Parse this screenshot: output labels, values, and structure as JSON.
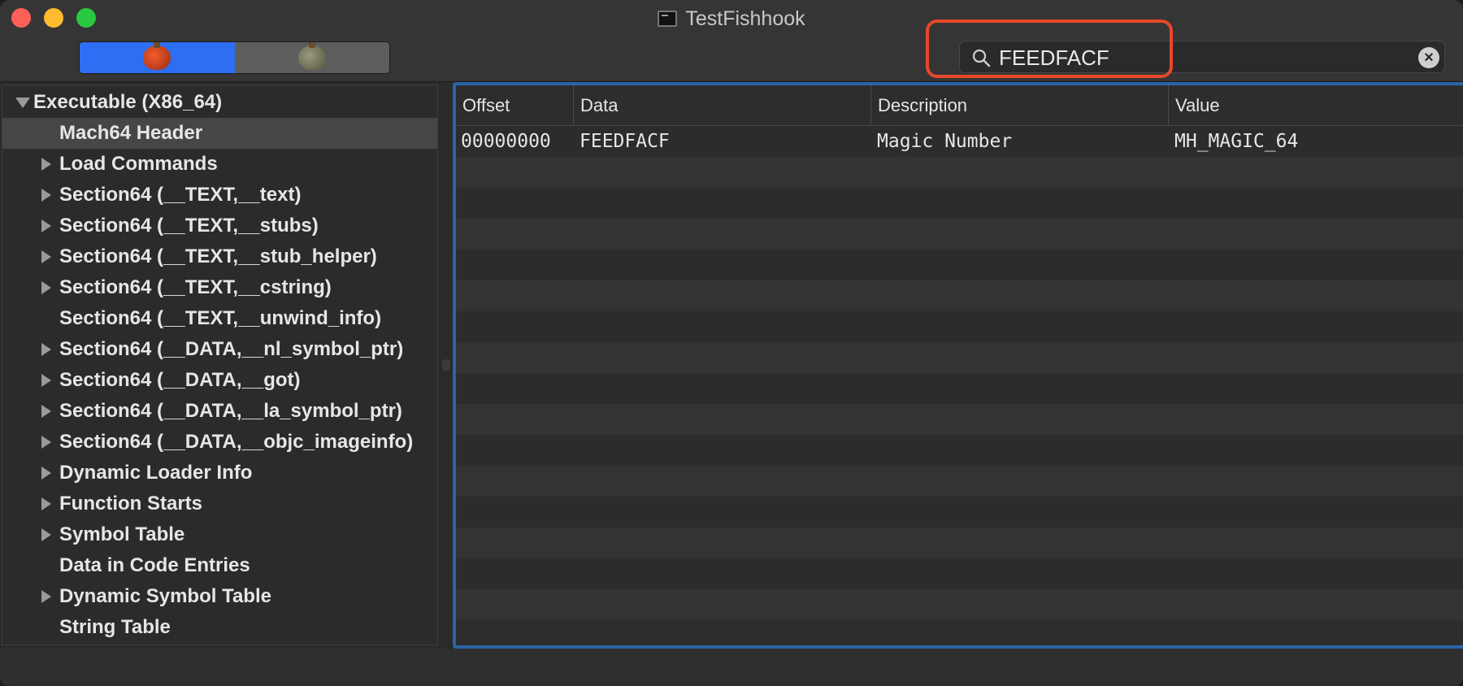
{
  "window": {
    "title": "TestFishhook",
    "title_icon": "terminal-icon"
  },
  "toolbar": {
    "segments": [
      {
        "icon": "apple-icon",
        "selected": true
      },
      {
        "icon": "pear-icon",
        "selected": false
      }
    ],
    "search": {
      "value": "FEEDFACF",
      "icon": "search-icon",
      "clear_icon": "clear-icon"
    }
  },
  "sidebar": {
    "items": [
      {
        "label": "Executable (X86_64)",
        "expander": "open",
        "selected": false
      },
      {
        "label": "Mach64 Header",
        "expander": "none",
        "selected": true
      },
      {
        "label": "Load Commands",
        "expander": "closed",
        "selected": false
      },
      {
        "label": "Section64 (__TEXT,__text)",
        "expander": "closed",
        "selected": false
      },
      {
        "label": "Section64 (__TEXT,__stubs)",
        "expander": "closed",
        "selected": false
      },
      {
        "label": "Section64 (__TEXT,__stub_helper)",
        "expander": "closed",
        "selected": false
      },
      {
        "label": "Section64 (__TEXT,__cstring)",
        "expander": "closed",
        "selected": false
      },
      {
        "label": "Section64 (__TEXT,__unwind_info)",
        "expander": "none",
        "selected": false
      },
      {
        "label": "Section64 (__DATA,__nl_symbol_ptr)",
        "expander": "closed",
        "selected": false
      },
      {
        "label": "Section64 (__DATA,__got)",
        "expander": "closed",
        "selected": false
      },
      {
        "label": "Section64 (__DATA,__la_symbol_ptr)",
        "expander": "closed",
        "selected": false
      },
      {
        "label": "Section64 (__DATA,__objc_imageinfo)",
        "expander": "closed",
        "selected": false
      },
      {
        "label": "Dynamic Loader Info",
        "expander": "closed",
        "selected": false
      },
      {
        "label": "Function Starts",
        "expander": "closed",
        "selected": false
      },
      {
        "label": "Symbol Table",
        "expander": "closed",
        "selected": false
      },
      {
        "label": "Data in Code Entries",
        "expander": "none",
        "selected": false
      },
      {
        "label": "Dynamic Symbol Table",
        "expander": "closed",
        "selected": false
      },
      {
        "label": "String Table",
        "expander": "none",
        "selected": false
      }
    ]
  },
  "table": {
    "columns": [
      "Offset",
      "Data",
      "Description",
      "Value"
    ],
    "rows": [
      [
        "00000000",
        "FEEDFACF",
        "Magic Number",
        "MH_MAGIC_64"
      ]
    ],
    "empty_rows": 15
  },
  "colors": {
    "accent": "#2e6ef3",
    "focus_ring": "#2b64a6",
    "annotation": "#e6482a",
    "background": "#2a2a2a"
  }
}
